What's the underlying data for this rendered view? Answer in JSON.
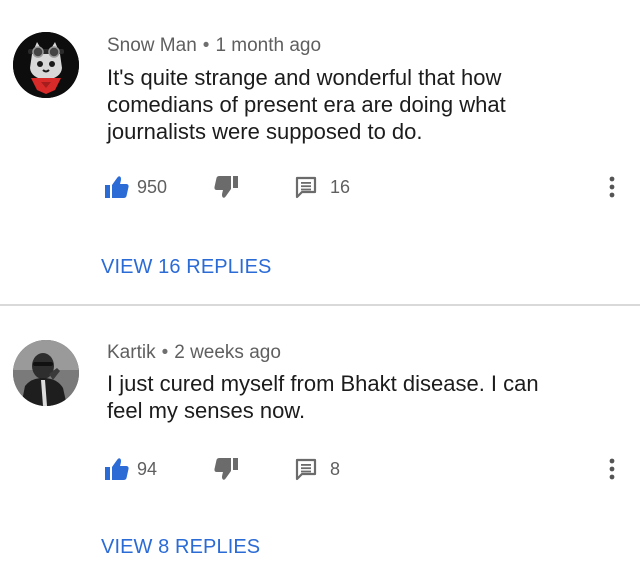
{
  "comments": [
    {
      "author": "Snow Man",
      "separator": "•",
      "time": "1 month ago",
      "text": "It's quite strange and wonderful that how comedians of present era are doing what journalists were supposed to do.",
      "likes": "950",
      "replies": "16",
      "view_replies_label": "VIEW 16 REPLIES"
    },
    {
      "author": "Kartik",
      "separator": "•",
      "time": "2 weeks ago",
      "text": "I just cured myself from Bhakt disease. I can feel my senses now.",
      "likes": "94",
      "replies": "8",
      "view_replies_label": "VIEW 8 REPLIES"
    }
  ],
  "icons": {
    "like": "thumbs-up-icon",
    "dislike": "thumbs-down-icon",
    "reply": "comment-icon",
    "more": "more-vert-icon"
  },
  "colors": {
    "like_active": "#2b6bd6",
    "link": "#2b6bd6",
    "icon": "#6b6b6b",
    "meta_text": "#5f5f5f",
    "body_text": "#1c1c1c"
  }
}
